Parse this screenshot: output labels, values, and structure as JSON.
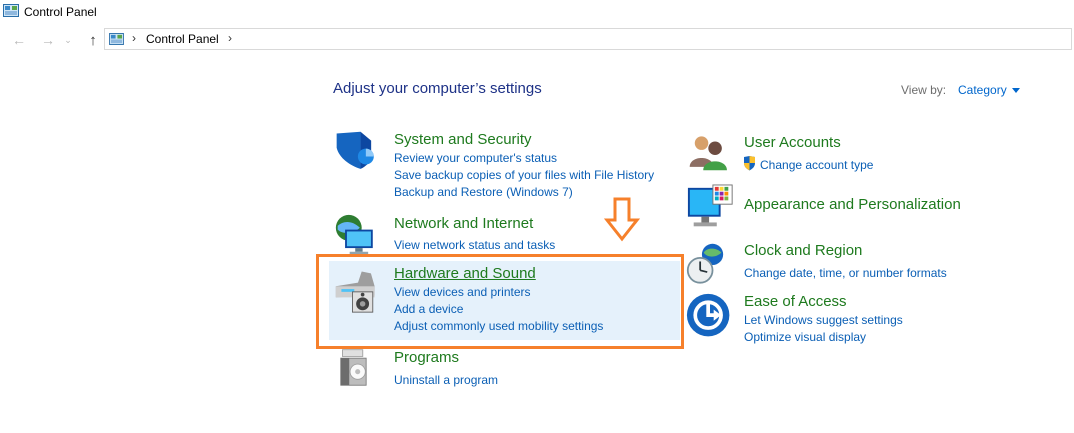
{
  "window": {
    "title": "Control Panel"
  },
  "address_bar": {
    "crumb": "Control Panel"
  },
  "main": {
    "heading": "Adjust your computer’s settings",
    "view_by_label": "View by:",
    "view_by_value": "Category"
  },
  "categories": {
    "system_security": {
      "title": "System and Security",
      "links": [
        "Review your computer's status",
        "Save backup copies of your files with File History",
        "Backup and Restore (Windows 7)"
      ]
    },
    "network": {
      "title": "Network and Internet",
      "links": [
        "View network status and tasks"
      ]
    },
    "hardware": {
      "title": "Hardware and Sound",
      "links": [
        "View devices and printers",
        "Add a device",
        "Adjust commonly used mobility settings"
      ]
    },
    "programs": {
      "title": "Programs",
      "links": [
        "Uninstall a program"
      ]
    },
    "user_accounts": {
      "title": "User Accounts",
      "links": [
        "Change account type"
      ]
    },
    "appearance": {
      "title": "Appearance and Personalization",
      "links": []
    },
    "clock": {
      "title": "Clock and Region",
      "links": [
        "Change date, time, or number formats"
      ]
    },
    "ease": {
      "title": "Ease of Access",
      "links": [
        "Let Windows suggest settings",
        "Optimize visual display"
      ]
    }
  },
  "colors": {
    "heading": "#1e3287",
    "category_title": "#1e7a1e",
    "link": "#0b5fb5",
    "highlight_bg": "#e5f1fb",
    "annotation": "#f6802b"
  },
  "icons": {
    "window": "control-panel-icon",
    "back": "back-arrow-icon",
    "forward": "forward-arrow-icon",
    "recent": "chevron-down-icon",
    "up": "up-arrow-icon",
    "annotation": "down-arrow-annotation-icon"
  }
}
